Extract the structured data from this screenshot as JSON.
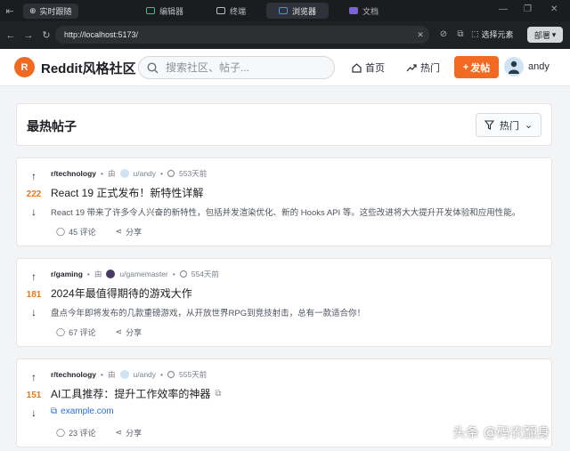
{
  "ide": {
    "live_label": "实时跟随",
    "tabs": [
      {
        "label": "编辑器"
      },
      {
        "label": "终端"
      },
      {
        "label": "浏览器"
      },
      {
        "label": "文档"
      }
    ]
  },
  "browser": {
    "url": "http://localhost:5173/",
    "select_element_label": "选择元素",
    "deploy_label": "部署"
  },
  "site": {
    "logo_letter": "R",
    "name": "Reddit风格社区",
    "search_placeholder": "搜索社区、帖子...",
    "nav_home": "首页",
    "nav_hot": "热门",
    "post_button": "发帖",
    "username": "andy"
  },
  "feed": {
    "title": "最热帖子",
    "filter_label": "热门",
    "posts": [
      {
        "votes": "222",
        "subreddit": "r/technology",
        "by": "由",
        "author": "u/andy",
        "time": "553天前",
        "title": "React 19 正式发布！新特性详解",
        "body": "React 19 带来了许多令人兴奋的新特性，包括并发渲染优化、新的 Hooks API 等。这些改进将大大提升开发体验和应用性能。",
        "comments": "45 评论",
        "share": "分享"
      },
      {
        "votes": "181",
        "subreddit": "r/gaming",
        "by": "由",
        "author": "u/gamemaster",
        "time": "554天前",
        "title": "2024年最值得期待的游戏大作",
        "body": "盘点今年即将发布的几款重磅游戏，从开放世界RPG到竞技射击，总有一款适合你！",
        "comments": "67 评论",
        "share": "分享"
      },
      {
        "votes": "151",
        "subreddit": "r/technology",
        "by": "由",
        "author": "u/andy",
        "time": "555天前",
        "title": "AI工具推荐：提升工作效率的神器",
        "link": "example.com",
        "comments": "23 评论",
        "share": "分享"
      }
    ]
  },
  "watermark": "头条 @码农翻身"
}
